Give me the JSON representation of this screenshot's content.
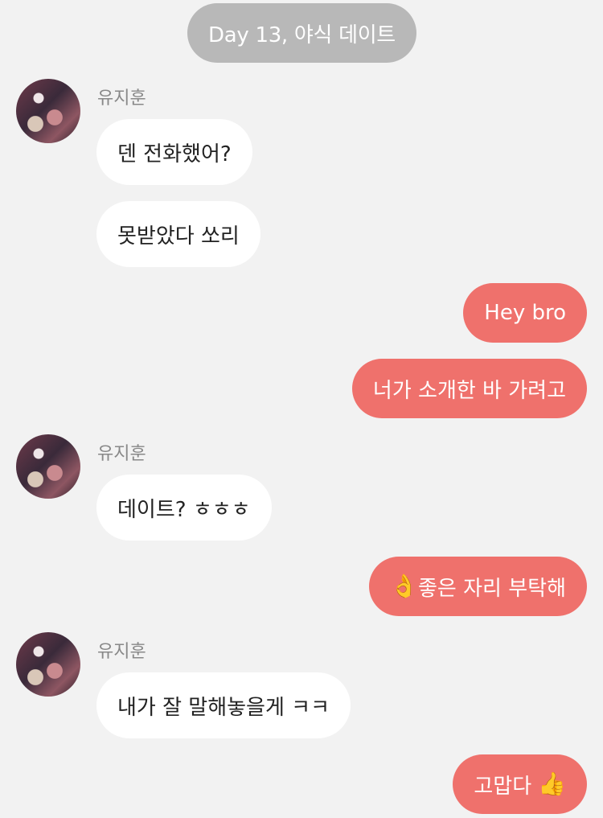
{
  "day_separator": "Day 13, 야식 데이트",
  "contact": {
    "name": "유지훈"
  },
  "messages": [
    {
      "from": "contact",
      "text": "덴 전화했어?"
    },
    {
      "from": "contact",
      "text": "못받았다 쏘리"
    },
    {
      "from": "me",
      "text": "Hey bro"
    },
    {
      "from": "me",
      "text": "너가 소개한 바 가려고"
    },
    {
      "from": "contact",
      "text": "데이트? ㅎㅎㅎ"
    },
    {
      "from": "me",
      "emoji": "👌",
      "text": "좋은 자리 부탁해"
    },
    {
      "from": "contact",
      "text": "내가 잘 말해놓을게 ㅋㅋ"
    },
    {
      "from": "me",
      "text": "고맙다",
      "emoji": "👍"
    }
  ],
  "colors": {
    "background": "#f2f2f2",
    "outgoing_bubble": "#ef716c",
    "incoming_bubble": "#ffffff",
    "day_pill": "#b8b8b8"
  }
}
